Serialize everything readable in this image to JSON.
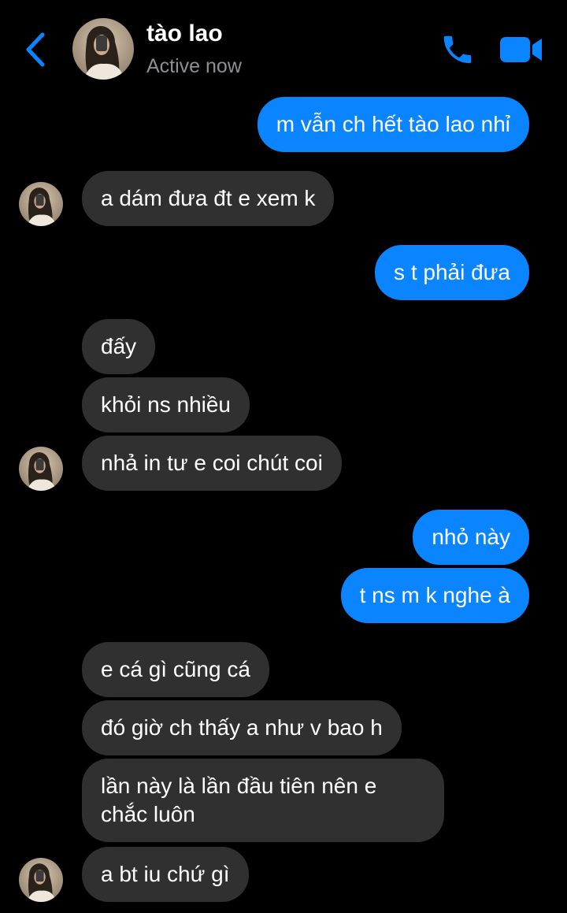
{
  "header": {
    "contact_name": "tào lao",
    "status": "Active now"
  },
  "accent_color": "#0a84ff",
  "incoming_bubble_color": "#303030",
  "icons": {
    "back": "chevron-left-icon",
    "call": "phone-icon",
    "video": "video-camera-icon"
  },
  "messages": [
    {
      "direction": "outgoing",
      "text": "m vẫn ch hết tào lao nhỉ"
    },
    {
      "direction": "incoming",
      "text": "a dám đưa đt e xem k"
    },
    {
      "direction": "outgoing",
      "text": "s t phải đưa"
    },
    {
      "direction": "incoming",
      "text": "đấy"
    },
    {
      "direction": "incoming",
      "text": "khỏi ns nhiều"
    },
    {
      "direction": "incoming",
      "text": "nhả in tư e coi chút coi"
    },
    {
      "direction": "outgoing",
      "text": "nhỏ này"
    },
    {
      "direction": "outgoing",
      "text": "t ns m k nghe à"
    },
    {
      "direction": "incoming",
      "text": "e cá gì cũng cá"
    },
    {
      "direction": "incoming",
      "text": "đó giờ ch thấy a như v bao h"
    },
    {
      "direction": "incoming",
      "text": "lần này là lần đầu tiên nên e chắc luôn"
    },
    {
      "direction": "incoming",
      "text": "a bt iu chứ gì"
    }
  ]
}
